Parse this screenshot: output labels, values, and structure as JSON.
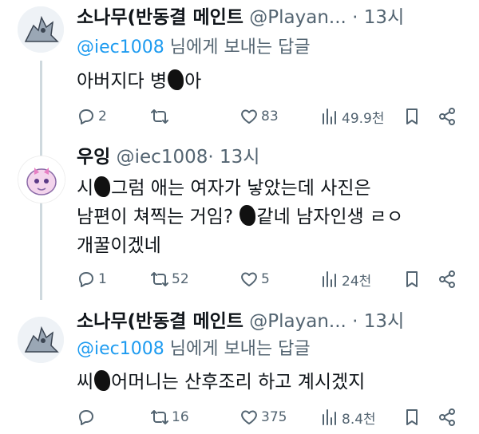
{
  "tweets": [
    {
      "name": "소나무(반동결 메인트",
      "handle": "@Playan...",
      "sep": "·",
      "time": "13시",
      "reply_mention": "@iec1008",
      "reply_suffix": " 님에게 보내는 답글",
      "lines": [
        {
          "before": "아버지다 병",
          "after": "아"
        }
      ],
      "actions": {
        "reply": "2",
        "retweet": "",
        "like": "83",
        "views": "49.9천"
      }
    },
    {
      "name": "우잉",
      "handle": "@iec1008",
      "sep": "·",
      "time": "13시",
      "lines": [
        {
          "before": "시",
          "after": "그럼 애는 여자가 낳았는데 사진은"
        },
        {
          "before": "남편이 쳐찍는 거임? ",
          "after": "같네 남자인생 ㄹㅇ"
        },
        {
          "before": "개꿀이겠네",
          "after": ""
        }
      ],
      "actions": {
        "reply": "1",
        "retweet": "52",
        "like": "5",
        "views": "24천"
      }
    },
    {
      "name": "소나무(반동결 메인트",
      "handle": "@Playan...",
      "sep": "·",
      "time": "13시",
      "reply_mention": "@iec1008",
      "reply_suffix": " 님에게 보내는 답글",
      "lines": [
        {
          "before": "씨",
          "after": "어머니는 산후조리 하고 계시겠지"
        }
      ],
      "actions": {
        "reply": "",
        "retweet": "16",
        "like": "375",
        "views": "8.4천"
      }
    }
  ],
  "icons": {
    "reply": "reply-icon",
    "retweet": "retweet-icon",
    "like": "heart-icon",
    "views": "views-icon",
    "bookmark": "bookmark-icon",
    "share": "share-icon"
  },
  "colors": {
    "text": "#0f1419",
    "secondary": "#536471",
    "accent": "#1d9bf0",
    "line": "#cfd9de"
  }
}
